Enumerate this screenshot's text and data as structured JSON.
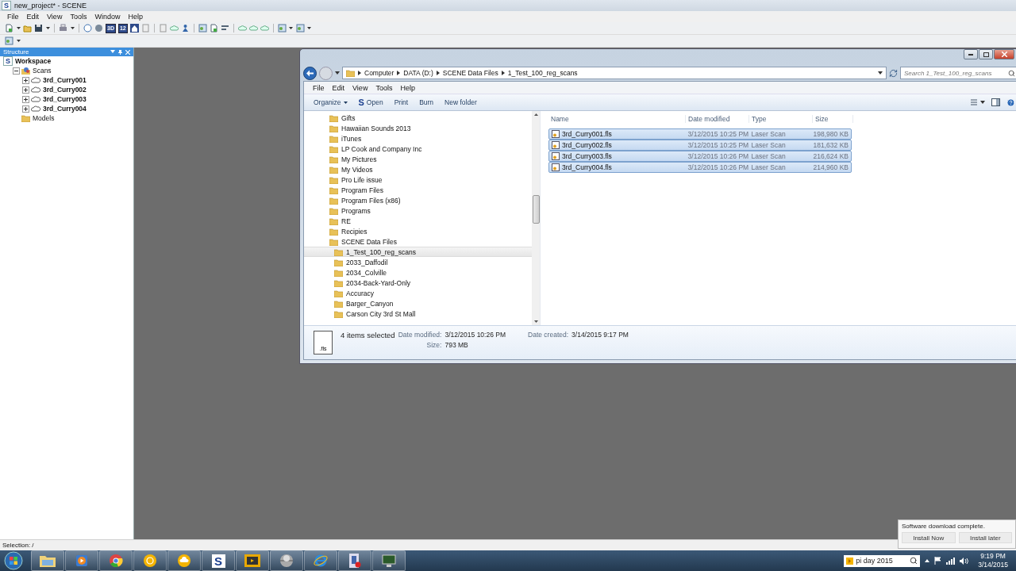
{
  "app": {
    "title": "new_project* - SCENE",
    "logo": "S",
    "menu": [
      "File",
      "Edit",
      "View",
      "Tools",
      "Window",
      "Help"
    ],
    "toolbar": [
      {
        "kind": "doc"
      },
      {
        "kind": "caret"
      },
      {
        "kind": "folder"
      },
      {
        "kind": "save"
      },
      {
        "kind": "caret"
      },
      {
        "kind": "sep"
      },
      {
        "kind": "print"
      },
      {
        "kind": "caret"
      },
      {
        "kind": "sep"
      },
      {
        "kind": "help"
      },
      {
        "kind": "sphere"
      },
      {
        "kind": "label",
        "label": "3D"
      },
      {
        "kind": "label",
        "label": "12"
      },
      {
        "kind": "home"
      },
      {
        "kind": "page"
      },
      {
        "kind": "sep"
      },
      {
        "kind": "page"
      },
      {
        "kind": "cloud"
      },
      {
        "kind": "person"
      },
      {
        "kind": "sep"
      },
      {
        "kind": "image"
      },
      {
        "kind": "doc"
      },
      {
        "kind": "filter"
      },
      {
        "kind": "sep"
      },
      {
        "kind": "cloud"
      },
      {
        "kind": "cloud"
      },
      {
        "kind": "cloud"
      },
      {
        "kind": "sep"
      },
      {
        "kind": "image"
      },
      {
        "kind": "caret"
      },
      {
        "kind": "image"
      },
      {
        "kind": "caret"
      }
    ],
    "toolbar_2": [
      {
        "kind": "image"
      },
      {
        "kind": "caret"
      }
    ],
    "structure": {
      "title": "Structure",
      "tree": [
        {
          "kind": "workspace",
          "icon": "S",
          "label": "Workspace",
          "children": [
            {
              "kind": "group",
              "label": "Scans",
              "expanded": true,
              "children": [
                {
                  "kind": "scan",
                  "label": "3rd_Curry001",
                  "expanded": false
                },
                {
                  "kind": "scan",
                  "label": "3rd_Curry002",
                  "expanded": false
                },
                {
                  "kind": "scan",
                  "label": "3rd_Curry003",
                  "expanded": false
                },
                {
                  "kind": "scan",
                  "label": "3rd_Curry004",
                  "expanded": false
                }
              ]
            },
            {
              "kind": "folder",
              "label": "Models"
            }
          ]
        }
      ]
    },
    "status_bar": "Selection: /"
  },
  "explorer": {
    "breadcrumb": [
      "Computer",
      "DATA (D:)",
      "SCENE Data Files",
      "1_Test_100_reg_scans"
    ],
    "search": {
      "placeholder": "Search 1_Test_100_reg_scans"
    },
    "menu": [
      "File",
      "Edit",
      "View",
      "Tools",
      "Help"
    ],
    "commands": [
      {
        "kind": "dropdown",
        "label": "Organize"
      },
      {
        "kind": "app",
        "icon": "S",
        "label": "Open"
      },
      {
        "kind": "plain",
        "label": "Print"
      },
      {
        "kind": "plain",
        "label": "Burn"
      },
      {
        "kind": "plain",
        "label": "New folder"
      }
    ],
    "nav": [
      {
        "label": "Gifts",
        "selected": false
      },
      {
        "label": "Hawaiian Sounds 2013",
        "selected": false
      },
      {
        "label": "iTunes",
        "selected": false
      },
      {
        "label": "LP Cook and Company Inc",
        "selected": false
      },
      {
        "label": "My Pictures",
        "selected": false
      },
      {
        "label": "My Videos",
        "selected": false
      },
      {
        "label": "Pro Life issue",
        "selected": false
      },
      {
        "label": "Program Files",
        "selected": false
      },
      {
        "label": "Program Files (x86)",
        "selected": false
      },
      {
        "label": "Programs",
        "selected": false
      },
      {
        "label": "RE",
        "selected": false
      },
      {
        "label": "Recipies",
        "selected": false
      },
      {
        "label": "SCENE Data Files",
        "selected": false,
        "children": [
          {
            "label": "1_Test_100_reg_scans",
            "selected": true
          },
          {
            "label": "2033_Daffodil",
            "selected": false
          },
          {
            "label": "2034_Colville",
            "selected": false
          },
          {
            "label": "2034-Back-Yard-Only",
            "selected": false
          },
          {
            "label": "Accuracy",
            "selected": false
          },
          {
            "label": "Barger_Canyon",
            "selected": false
          },
          {
            "label": "Carson City 3rd St Mall",
            "selected": false
          }
        ]
      }
    ],
    "columns": [
      "Name",
      "Date modified",
      "Type",
      "Size"
    ],
    "files": [
      {
        "name": "3rd_Curry001.fls",
        "modified": "3/12/2015 10:25 PM",
        "type": "Laser Scan",
        "size": "198,980 KB",
        "selected": true
      },
      {
        "name": "3rd_Curry002.fls",
        "modified": "3/12/2015 10:25 PM",
        "type": "Laser Scan",
        "size": "181,632 KB",
        "selected": true
      },
      {
        "name": "3rd_Curry003.fls",
        "modified": "3/12/2015 10:26 PM",
        "type": "Laser Scan",
        "size": "216,624 KB",
        "selected": true
      },
      {
        "name": "3rd_Curry004.fls",
        "modified": "3/12/2015 10:26 PM",
        "type": "Laser Scan",
        "size": "214,960 KB",
        "selected": true
      }
    ],
    "details": {
      "thumb": ".fls",
      "count": "4 items selected",
      "modified_label": "Date modified:",
      "modified": "3/12/2015 10:26 PM",
      "size_label": "Size:",
      "size": "793 MB",
      "created_label": "Date created:",
      "created": "3/14/2015 9:17 PM"
    }
  },
  "notification": {
    "message": "Software download complete.",
    "buttons": [
      "Install Now",
      "Install later"
    ]
  },
  "taskbar": {
    "apps": [
      {
        "kind": "explorer"
      },
      {
        "kind": "media"
      },
      {
        "kind": "chrome"
      },
      {
        "kind": "sun"
      },
      {
        "kind": "cloud"
      },
      {
        "kind": "letter",
        "label": "S"
      },
      {
        "kind": "player"
      },
      {
        "kind": "globe"
      },
      {
        "kind": "ie"
      },
      {
        "kind": "video"
      },
      {
        "kind": "monitor"
      }
    ],
    "search": "pi day 2015",
    "time": "9:19 PM",
    "date": "3/14/2015"
  }
}
